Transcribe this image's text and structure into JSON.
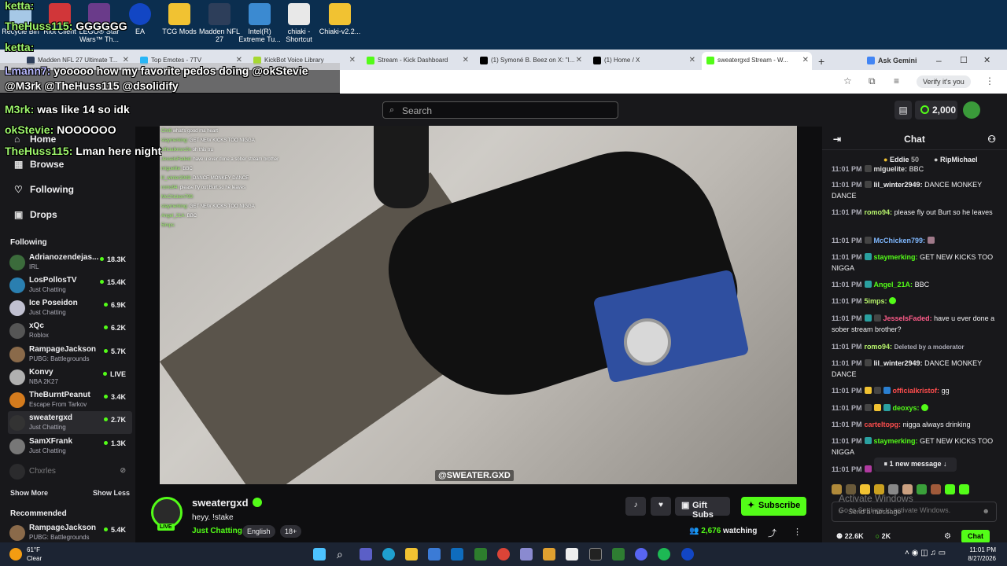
{
  "overlay_chat": [
    {
      "name": "ketta:",
      "text": ""
    },
    {
      "name": "TheHuss115:",
      "text": "GGGGGG"
    },
    {
      "name": "ketta:",
      "text": ""
    },
    {
      "name": "Lmann7:",
      "text": "yooooo how my favorite pedos doing @okStevie"
    },
    {
      "name": "",
      "text": "@M3rk @TheHuss115 @dsolidify"
    },
    {
      "name": "M3rk:",
      "text": "was like 14 so idk"
    },
    {
      "name": "okStevie:",
      "text": "NOOOOOO"
    },
    {
      "name": "TheHuss115:",
      "text": "Lman here night"
    }
  ],
  "desktop_icons": [
    "Recycle Bin",
    "Riot Client",
    "LEGO® Star Wars™ Th...",
    "EA",
    "TCG Mods",
    "Madden NFL 27",
    "Intel(R) Extreme Tu...",
    "chiaki - Shortcut",
    "Chiaki-v2.2..."
  ],
  "tabs": [
    "Madden NFL 27 Ultimate T...",
    "Top Emotes - 7TV",
    "KickBot Voice Library",
    "Stream - Kick Dashboard",
    "(1) Symoné B. Beez on X: \"I...",
    "(1) Home / X",
    "sweatergxd Stream - W..."
  ],
  "browser": {
    "ask_gemini": "Ask Gemini",
    "verify": "Verify it's you"
  },
  "topbar": {
    "search_placeholder": "Search",
    "points": "2,000"
  },
  "nav": {
    "home": "Home",
    "browse": "Browse",
    "following": "Following",
    "drops": "Drops"
  },
  "following_header": "Following",
  "channels": [
    {
      "name": "Adrianozendejas...",
      "game": "IRL",
      "viewers": "18.3K",
      "color": "#3b6b3b"
    },
    {
      "name": "LosPollosTV",
      "game": "Just Chatting",
      "viewers": "15.4K",
      "color": "#2a7fb0"
    },
    {
      "name": "Ice Poseidon",
      "game": "Just Chatting",
      "viewers": "6.9K",
      "color": "#c0c0d0"
    },
    {
      "name": "xQc",
      "game": "Roblox",
      "viewers": "6.2K",
      "color": "#555"
    },
    {
      "name": "RampageJackson",
      "game": "PUBG: Battlegrounds",
      "viewers": "5.7K",
      "color": "#8a6a4a"
    },
    {
      "name": "Konvy",
      "game": "NBA 2K27",
      "viewers": "LIVE",
      "color": "#b0b0b0"
    },
    {
      "name": "TheBurntPeanut",
      "game": "Escape From Tarkov",
      "viewers": "3.4K",
      "color": "#d47b1d"
    },
    {
      "name": "sweatergxd",
      "game": "Just Chatting",
      "viewers": "2.7K",
      "color": "#333"
    },
    {
      "name": "SamXFrank",
      "game": "Just Chatting",
      "viewers": "1.3K",
      "color": "#777"
    },
    {
      "name": "Chxrles",
      "game": "",
      "viewers": "",
      "color": "#444"
    }
  ],
  "show_more": "Show More",
  "show_less": "Show Less",
  "recommended_header": "Recommended",
  "recommended": [
    {
      "name": "RampageJackson",
      "game": "PUBG: Battlegrounds",
      "viewers": "5.4K",
      "color": "#8a6a4a"
    }
  ],
  "video_overlay_lines": [
    {
      "user": "Chr8",
      "text": "what's good ma heart"
    },
    {
      "user": "staymerking:",
      "text": "GET NEW KICKS TOO NIGGA"
    },
    {
      "user": "officialkrisrc0n",
      "text": "oh this tru"
    },
    {
      "user": "JesselsFaded:",
      "text": "have u ever done a sober stream brother"
    },
    {
      "user": "miguelite:",
      "text": "BBC"
    },
    {
      "user": "lil_winter2949:",
      "text": "DANCE MONKEY DANCE"
    },
    {
      "user": "romo94:",
      "text": "please fly out Burt so he leaves"
    },
    {
      "user": "McChicken799:",
      "text": ""
    },
    {
      "user": "staymerking:",
      "text": "GET NEW KICKS TOO NIGGA"
    },
    {
      "user": "Angel_21A:",
      "text": "BBC"
    },
    {
      "user": "5imps:",
      "text": ""
    }
  ],
  "watermark": "@SWEATER.GXD",
  "stream": {
    "name": "sweatergxd",
    "title": "heyy. !stake",
    "category": "Just Chatting",
    "tags": [
      "English",
      "18+"
    ],
    "live": "LIVE",
    "gift_subs": "Gift Subs",
    "subscribe": "Subscribe",
    "watching_count": "2,676",
    "watching_label": "watching"
  },
  "chat": {
    "header": "Chat",
    "leaderboard": [
      {
        "name": "Eddie",
        "score": "50"
      },
      {
        "name": "RipMichael",
        "score": ""
      }
    ],
    "messages": [
      {
        "time": "11:01 PM",
        "user": "miguelite:",
        "text": "BBC",
        "color": "#e0e0e0"
      },
      {
        "time": "11:01 PM",
        "user": "lil_winter2949:",
        "text": "DANCE MONKEY DANCE",
        "color": "#efeff1"
      },
      {
        "time": "11:01 PM",
        "user": "romo94:",
        "text": "please fly out Burt so he leaves",
        "color": "#b6f36b"
      },
      {
        "time": "11:01 PM",
        "user": "McChicken799:",
        "text": "",
        "color": "#7fb8ff"
      },
      {
        "time": "11:01 PM",
        "user": "staymerking:",
        "text": "GET NEW KICKS TOO NIGGA",
        "color": "#53fc18"
      },
      {
        "time": "11:01 PM",
        "user": "Angel_21A:",
        "text": "BBC",
        "color": "#53fc18"
      },
      {
        "time": "11:01 PM",
        "user": "5imps:",
        "text": "",
        "color": "#b6f36b"
      },
      {
        "time": "11:01 PM",
        "user": "JesselsFaded:",
        "text": "have u ever done a sober stream brother?",
        "color": "#ff5c8a"
      },
      {
        "time": "11:01 PM",
        "user": "romo94:",
        "text": "Deleted by a moderator",
        "color": "#b6f36b"
      },
      {
        "time": "11:01 PM",
        "user": "lil_winter2949:",
        "text": "DANCE MONKEY DANCE",
        "color": "#efeff1"
      },
      {
        "time": "11:01 PM",
        "user": "officialkristof:",
        "text": "gg",
        "color": "#ff4d4d"
      },
      {
        "time": "11:01 PM",
        "user": "deoxys:",
        "text": "",
        "color": "#53fc18"
      },
      {
        "time": "11:01 PM",
        "user": "carteltopg:",
        "text": "nigga always drinking",
        "color": "#ff4d4d"
      },
      {
        "time": "11:01 PM",
        "user": "staymerking:",
        "text": "GET NEW KICKS TOO NIGGA",
        "color": "#53fc18"
      },
      {
        "time": "11:01 PM",
        "user": "",
        "text": "",
        "color": "#efeff1"
      }
    ],
    "new_message": "1 new message ↓",
    "send_placeholder": "Send a message",
    "followers": "22.6K",
    "points": "2K",
    "chat_button": "Chat"
  },
  "windows": {
    "activate": "Activate Windows",
    "activate_sub": "Go to Settings to activate Windows."
  },
  "taskbar": {
    "temp": "61°F",
    "weather": "Clear",
    "time": "11:01 PM",
    "date": "8/27/2026"
  },
  "colors": {
    "accent": "#53fc18",
    "bg": "#0e0e10",
    "panel": "#18181b"
  }
}
